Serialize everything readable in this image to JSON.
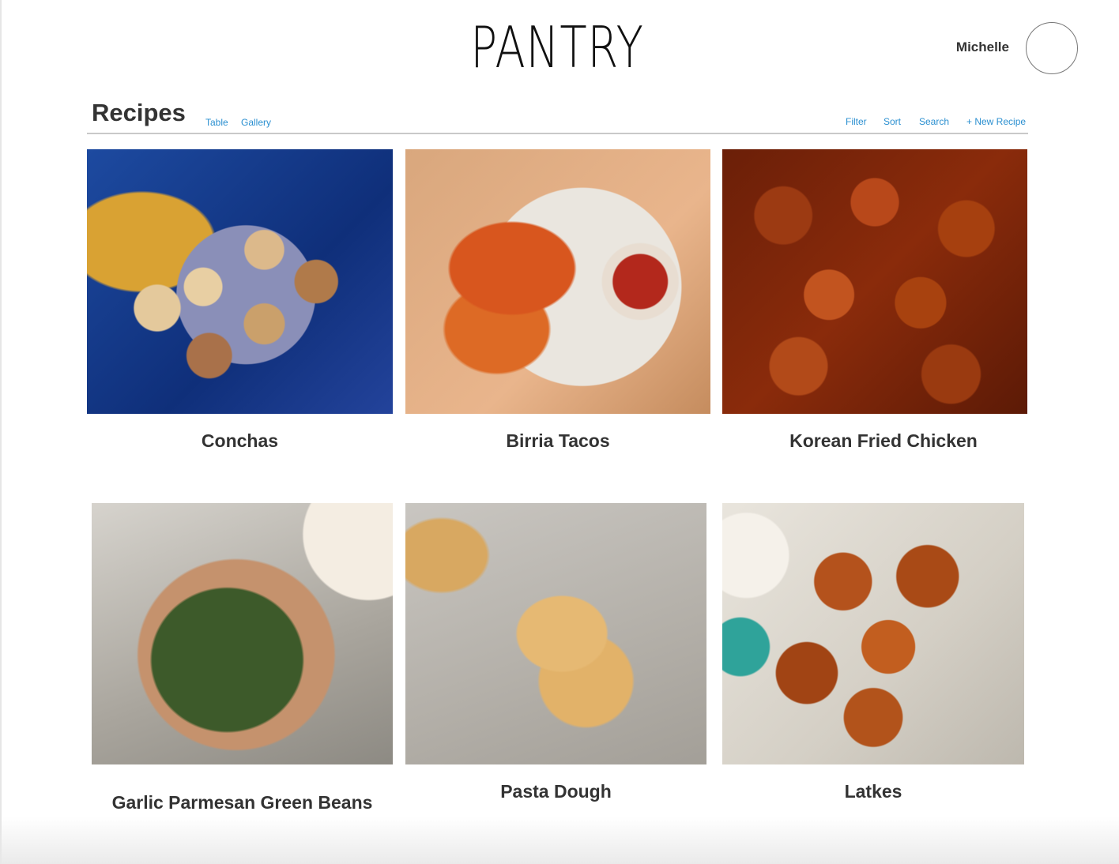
{
  "header": {
    "logo_text": "PANTRY",
    "user_name": "Michelle"
  },
  "toolbar": {
    "title": "Recipes",
    "views": [
      "Table",
      "Gallery"
    ],
    "actions": [
      "Filter",
      "Sort",
      "Search",
      "+ New Recipe"
    ]
  },
  "recipes": [
    {
      "name": "Conchas",
      "image": "conchas-photo"
    },
    {
      "name": "Birria Tacos",
      "image": "birria-tacos-photo"
    },
    {
      "name": "Korean Fried Chicken",
      "image": "korean-fried-chicken-photo"
    },
    {
      "name": "Garlic Parmesan Green Beans",
      "image": "green-beans-photo"
    },
    {
      "name": "Pasta Dough",
      "image": "pasta-dough-photo"
    },
    {
      "name": "Latkes",
      "image": "latkes-photo"
    }
  ],
  "colors": {
    "link": "#2a8fd0",
    "text": "#333333",
    "divider": "#c9c9c9"
  }
}
